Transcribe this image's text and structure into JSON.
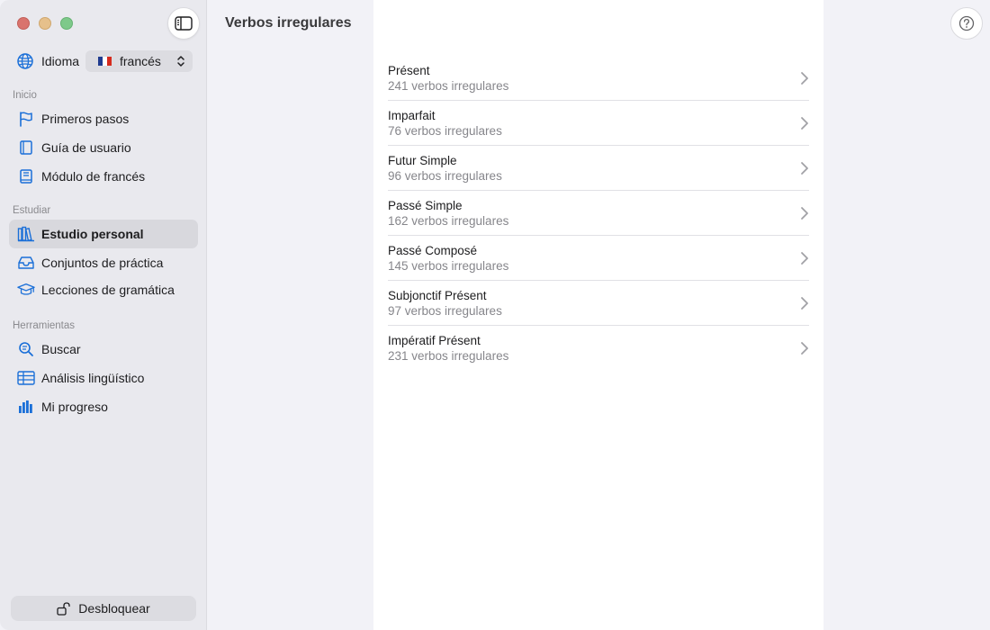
{
  "window": {
    "title": "Verbos irregulares"
  },
  "sidebar": {
    "language": {
      "label": "Idioma",
      "selected": "francés",
      "flag_colors": [
        "#1f3b8f",
        "#ffffff",
        "#d52b1e"
      ]
    },
    "sections": [
      {
        "title": "Inicio",
        "items": [
          {
            "label": "Primeros pasos",
            "icon": "flag-icon"
          },
          {
            "label": "Guía de usuario",
            "icon": "book-icon"
          },
          {
            "label": "Módulo de francés",
            "icon": "book-closed-icon"
          }
        ]
      },
      {
        "title": "Estudiar",
        "items": [
          {
            "label": "Estudio personal",
            "icon": "books-icon",
            "active": true
          },
          {
            "label": "Conjuntos de práctica",
            "icon": "tray-icon"
          },
          {
            "label": "Lecciones de gramática",
            "icon": "graduation-cap-icon"
          }
        ]
      },
      {
        "title": "Herramientas",
        "items": [
          {
            "label": "Buscar",
            "icon": "search-icon"
          },
          {
            "label": "Análisis lingüístico",
            "icon": "table-icon"
          },
          {
            "label": "Mi progreso",
            "icon": "bar-chart-icon"
          }
        ]
      }
    ],
    "unlock_label": "Desbloquear"
  },
  "list": [
    {
      "name": "Présent",
      "count": "241 verbos irregulares"
    },
    {
      "name": "Imparfait",
      "count": "76 verbos irregulares"
    },
    {
      "name": "Futur Simple",
      "count": "96 verbos irregulares"
    },
    {
      "name": "Passé Simple",
      "count": "162 verbos irregulares"
    },
    {
      "name": "Passé Composé",
      "count": "145 verbos irregulares"
    },
    {
      "name": "Subjonctif Présent",
      "count": "97 verbos irregulares"
    },
    {
      "name": "Impératif Présent",
      "count": "231 verbos irregulares"
    }
  ],
  "colors": {
    "accent": "#1a6fd8",
    "sidebar_bg": "#e9e9ee",
    "content_bg": "#ffffff"
  }
}
